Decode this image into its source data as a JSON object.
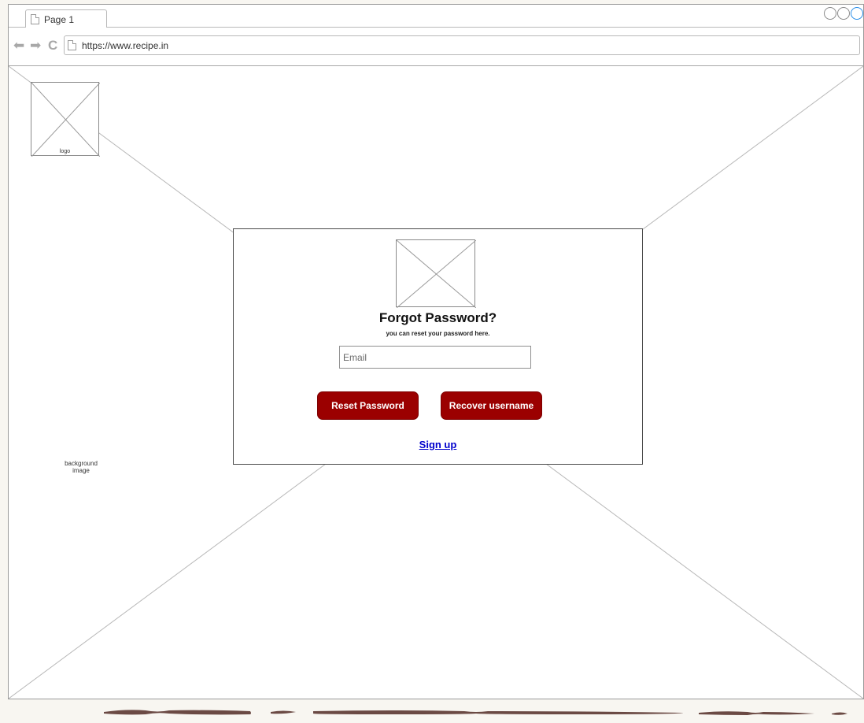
{
  "browser": {
    "tab_label": "Page 1",
    "url": "https://www.recipe.in"
  },
  "page": {
    "logo_label": "logo",
    "background_label": "background image"
  },
  "dialog": {
    "title": "Forgot Password?",
    "subtitle": "you can reset your password here.",
    "email_placeholder": "Email",
    "reset_button": "Reset Password",
    "recover_button": "Recover username",
    "signup_link": "Sign up"
  },
  "colors": {
    "button_red": "#9b0000",
    "link_blue": "#0000cc"
  }
}
